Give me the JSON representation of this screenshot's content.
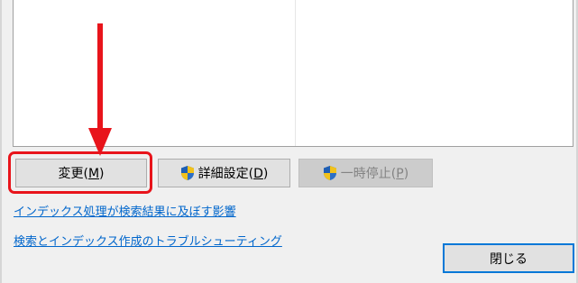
{
  "buttons": {
    "modify": {
      "label": "変更(",
      "mnemonic": "M",
      "suffix": ")"
    },
    "advanced": {
      "label": "詳細設定(",
      "mnemonic": "D",
      "suffix": ")"
    },
    "pause": {
      "label": "一時停止(",
      "mnemonic": "P",
      "suffix": ")"
    },
    "close": {
      "label": "閉じる"
    }
  },
  "links": {
    "impact": "インデックス処理が検索結果に及ぼす影響",
    "troubleshoot": "検索とインデックス作成のトラブルシューティング"
  },
  "icons": {
    "advanced": "uac-shield-icon",
    "pause": "uac-shield-icon"
  },
  "annotation": {
    "color": "#e8141b"
  }
}
